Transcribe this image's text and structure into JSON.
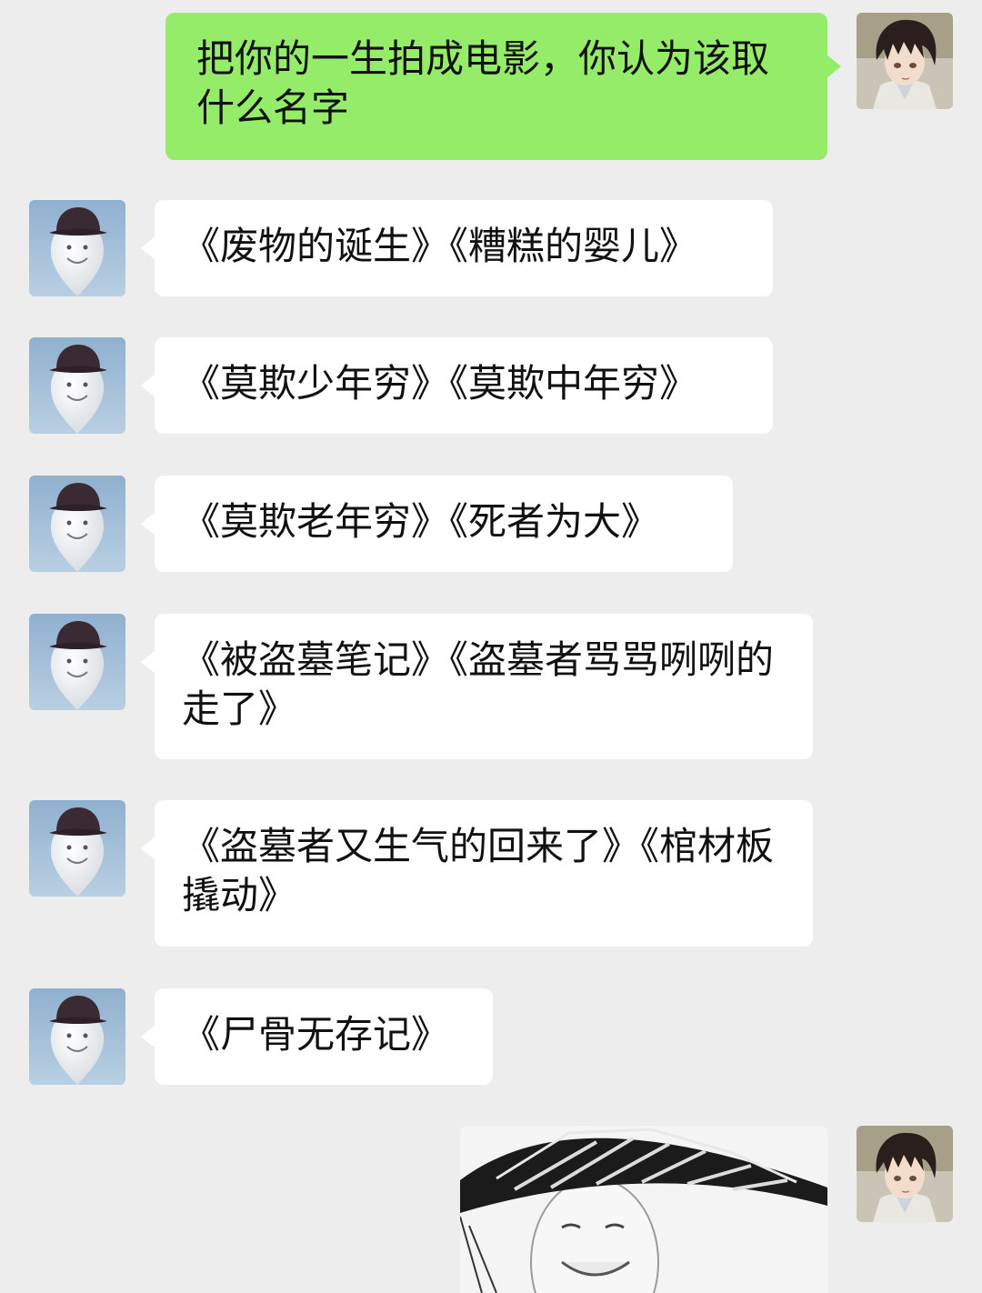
{
  "conversation": {
    "outgoing_question": "把你的一生拍成电影，你认为该取什么名字",
    "replies": [
      "《废物的诞生》《糟糕的婴儿》",
      "《莫欺少年穷》《莫欺中年穷》",
      "《莫欺老年穷》《死者为大》",
      "《被盗墓笔记》《盗墓者骂骂咧咧的走了》",
      "《盗墓者又生气的回来了》《棺材板撬动》",
      "《尸骨无存记》"
    ]
  },
  "icons": {
    "my_avatar": "anime-boy-avatar-icon",
    "friend_avatar": "smiley-balloon-hat-avatar-icon",
    "sticker": "straw-hat-smiling-face-meme"
  },
  "colors": {
    "chat_background": "#ededed",
    "my_bubble": "#95ec69",
    "friend_bubble": "#ffffff"
  }
}
